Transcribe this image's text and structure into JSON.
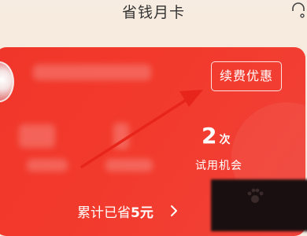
{
  "header": {
    "title": "省钱月卡",
    "support_icon": "headset-icon"
  },
  "card": {
    "renew_button_label": "续费优惠",
    "remaining_count": "2",
    "remaining_unit": "次",
    "remaining_label": "试用机会",
    "saved_prefix": "累计已省",
    "saved_amount": "5元",
    "saved_chevron_icon": "chevron-right-icon"
  },
  "colors": {
    "card_red": "#f0362a",
    "annotation_arrow": "#e8251b",
    "page_bg": "#f7ece1"
  }
}
